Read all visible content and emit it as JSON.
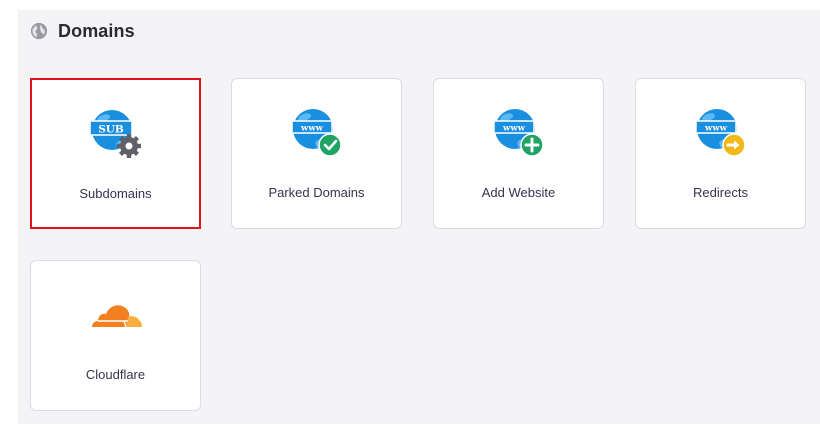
{
  "section": {
    "title": "Domains",
    "icon": "globe-icon"
  },
  "cards": [
    {
      "label": "Subdomains",
      "icon": "subdomain-globe-gear-icon",
      "globe_text": "SUB",
      "selected": true
    },
    {
      "label": "Parked Domains",
      "icon": "www-globe-check-icon",
      "globe_text": "www",
      "selected": false
    },
    {
      "label": "Add Website",
      "icon": "www-globe-plus-icon",
      "globe_text": "www",
      "selected": false
    },
    {
      "label": "Redirects",
      "icon": "www-globe-arrow-icon",
      "globe_text": "www",
      "selected": false
    },
    {
      "label": "Cloudflare",
      "icon": "cloudflare-cloud-icon",
      "selected": false
    }
  ],
  "colors": {
    "globe_blue": "#1a8fe0",
    "globe_light": "#5ab8f2",
    "badge_green": "#1fa463",
    "badge_yellow": "#f2b818",
    "gear_gray": "#5f6068",
    "cloudflare_orange": "#f38020",
    "cloudflare_light": "#faae40",
    "selected_border": "#e1131a"
  }
}
